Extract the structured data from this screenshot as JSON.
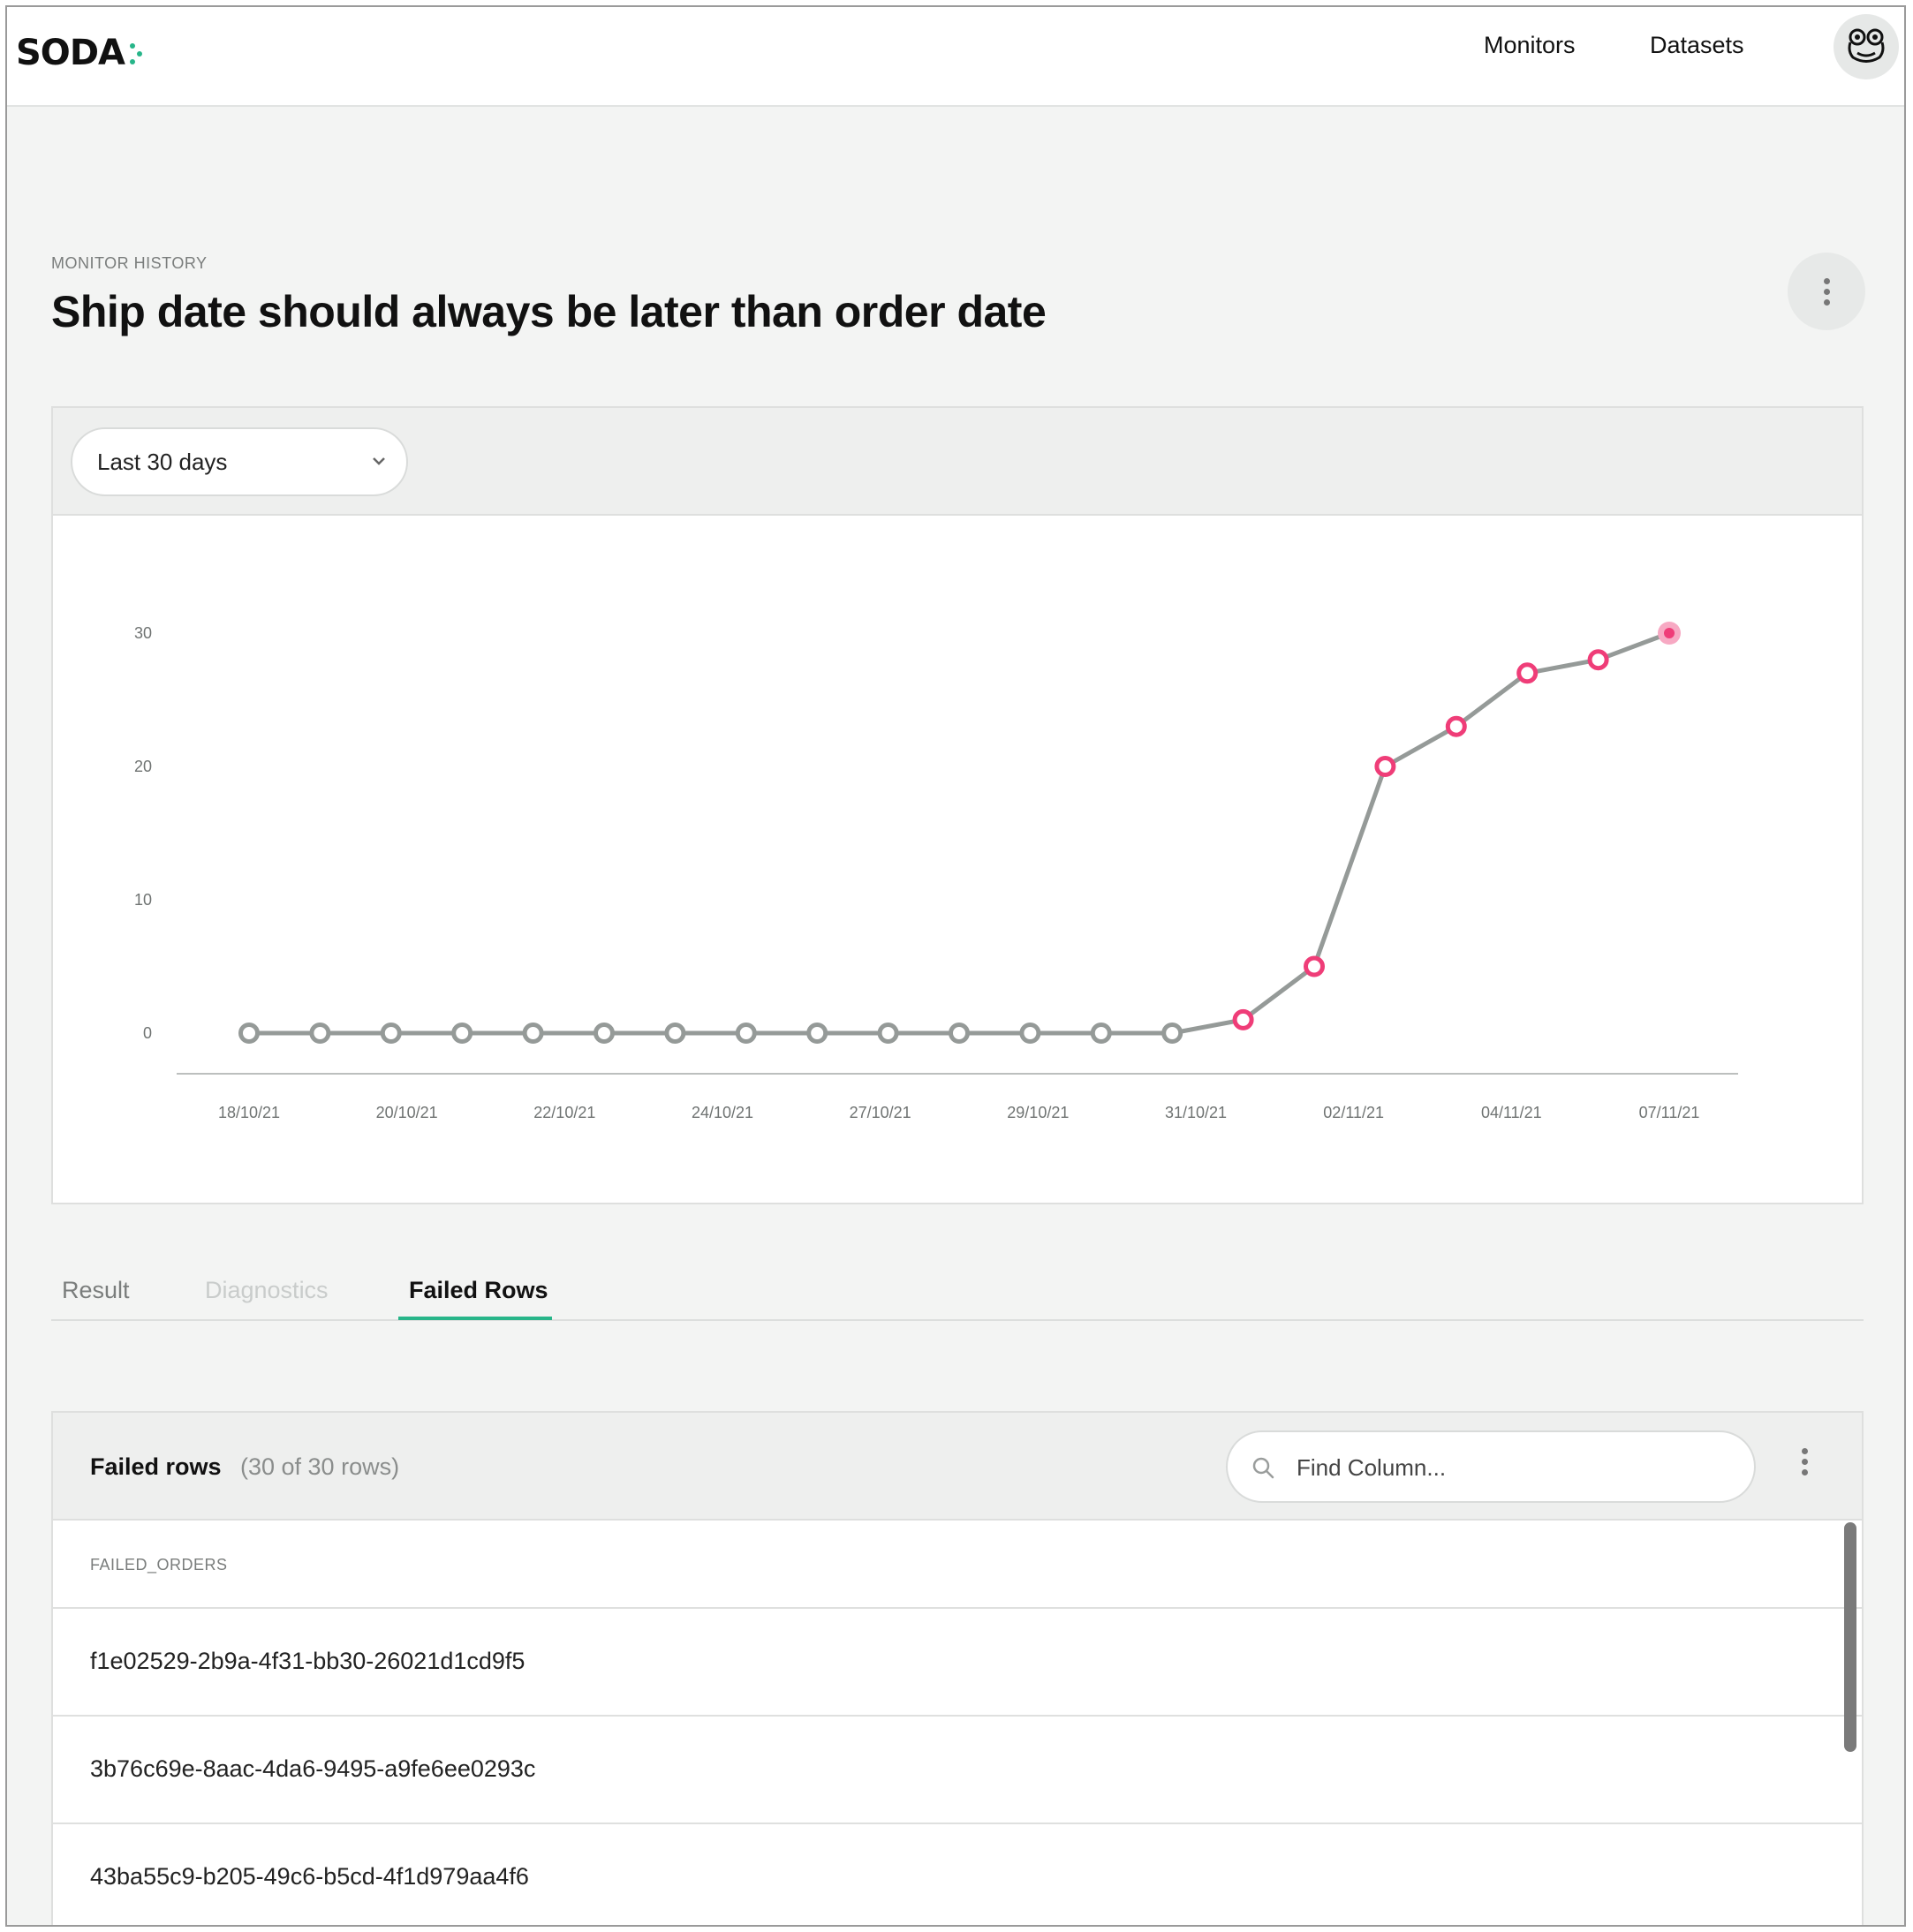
{
  "brand": {
    "logo_text": "SODA",
    "accent": "#27b589"
  },
  "nav": {
    "monitors": "Monitors",
    "datasets": "Datasets",
    "avatar_icon": "frog-avatar-icon"
  },
  "header": {
    "eyebrow": "MONITOR HISTORY",
    "title": "Ship date should always be later than order date",
    "more_icon": "kebab-vertical-icon"
  },
  "chart_filter": {
    "selected": "Last 30 days"
  },
  "chart_data": {
    "type": "line",
    "title": "",
    "xlabel": "",
    "ylabel": "",
    "ylim": [
      0,
      30
    ],
    "yticks": [
      0,
      10,
      20,
      30
    ],
    "x_tick_labels": [
      "18/10/21",
      "20/10/21",
      "22/10/21",
      "24/10/21",
      "27/10/21",
      "29/10/21",
      "31/10/21",
      "02/11/21",
      "04/11/21",
      "07/11/21"
    ],
    "series": [
      {
        "values": [
          0,
          0,
          0,
          0,
          0,
          0,
          0,
          0,
          0,
          0,
          0,
          0,
          0,
          0,
          1,
          5,
          20,
          23,
          27,
          28,
          30
        ],
        "status": [
          "pass",
          "pass",
          "pass",
          "pass",
          "pass",
          "pass",
          "pass",
          "pass",
          "pass",
          "pass",
          "pass",
          "pass",
          "pass",
          "pass",
          "fail",
          "fail",
          "fail",
          "fail",
          "fail",
          "fail",
          "latest-fail"
        ]
      }
    ],
    "colors": {
      "line": "#959a98",
      "pass": "#959a98",
      "fail": "#ef3d78",
      "latest_halo": "#f7a9c3",
      "axis": "#bcbfbe",
      "tick_text": "#6f7372"
    },
    "grid": false,
    "legend": "none"
  },
  "tabs": [
    {
      "label": "Result",
      "state": "inactive"
    },
    {
      "label": "Diagnostics",
      "state": "disabled"
    },
    {
      "label": "Failed Rows",
      "state": "active"
    }
  ],
  "failed_rows": {
    "title": "Failed rows",
    "count": "(30 of 30 rows)",
    "search_placeholder": "Find Column...",
    "column": "FAILED_ORDERS",
    "rows": [
      "f1e02529-2b9a-4f31-bb30-26021d1cd9f5",
      "3b76c69e-8aac-4da6-9495-a9fe6ee0293c",
      "43ba55c9-b205-49c6-b5cd-4f1d979aa4f6"
    ]
  }
}
